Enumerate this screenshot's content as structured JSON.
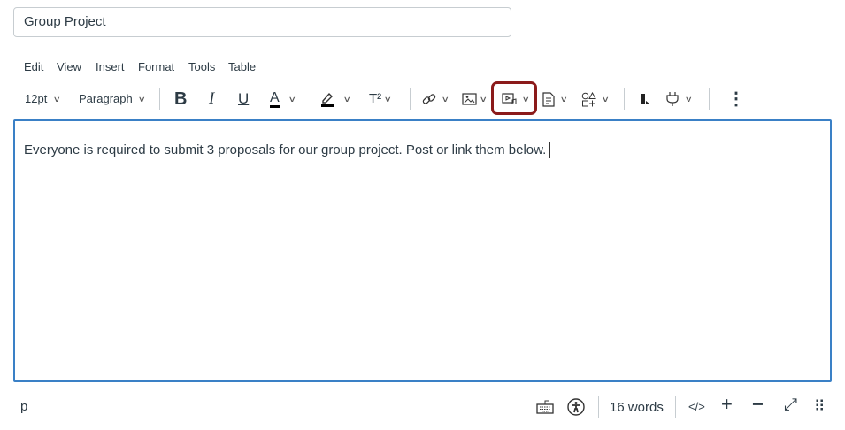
{
  "title_input": {
    "value": "Group Project"
  },
  "menubar": [
    "Edit",
    "View",
    "Insert",
    "Format",
    "Tools",
    "Table"
  ],
  "toolbar": {
    "font_size": "12pt",
    "block_format": "Paragraph",
    "bold": "B",
    "italic": "I",
    "underline": "U",
    "text_color": "A",
    "superscript": "T²",
    "more_icon": "⋮",
    "highlighted_button": "media-button",
    "highlight_color": "#8b1a1a"
  },
  "editor": {
    "content": "Everyone is required to submit 3 proposals for our group project. Post or link them below.",
    "border_color": "#3a80c6"
  },
  "statusbar": {
    "path": "p",
    "word_count": "16 words",
    "html_toggle": "</>",
    "zoom_in": "+",
    "zoom_out": "−",
    "fullscreen": "⤢",
    "drag": "⠿"
  }
}
